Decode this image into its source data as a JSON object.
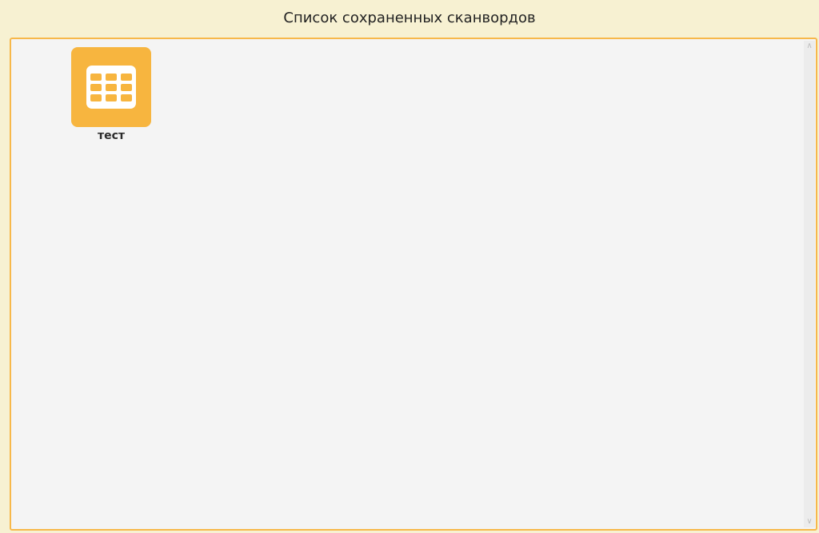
{
  "window": {
    "title": "Список сохраненных сканвордов"
  },
  "saved_list": {
    "items": [
      {
        "label": "тест",
        "icon": "grid-icon"
      }
    ]
  },
  "colors": {
    "background": "#f7f1d2",
    "panel_border": "#f7b84a",
    "tile": "#f7b53f"
  }
}
